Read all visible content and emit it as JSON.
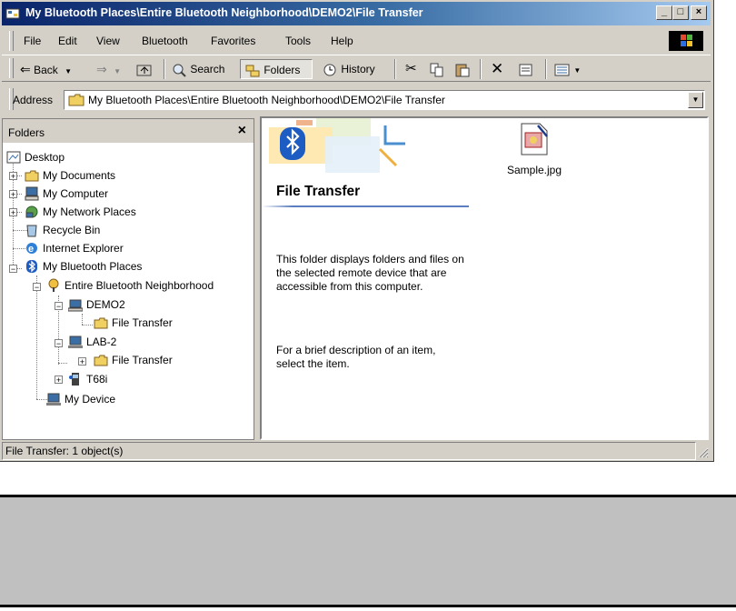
{
  "window": {
    "title": "My Bluetooth Places\\Entire Bluetooth Neighborhood\\DEMO2\\File Transfer",
    "minimize": "_",
    "maximize": "□",
    "close": "×"
  },
  "menu": [
    "File",
    "Edit",
    "View",
    "Bluetooth",
    "Favorites",
    "Tools",
    "Help"
  ],
  "toolbar": {
    "back": "Back",
    "search": "Search",
    "folders": "Folders",
    "history": "History"
  },
  "address": {
    "label": "Address",
    "value": "My Bluetooth Places\\Entire Bluetooth Neighborhood\\DEMO2\\File Transfer"
  },
  "folders_pane": {
    "title": "Folders",
    "close": "×",
    "tree": [
      {
        "label": "Desktop",
        "icon": "desktop-icon"
      },
      {
        "label": "My Documents",
        "icon": "my-documents-icon"
      },
      {
        "label": "My Computer",
        "icon": "my-computer-icon"
      },
      {
        "label": "My Network Places",
        "icon": "network-places-icon"
      },
      {
        "label": "Recycle Bin",
        "icon": "recycle-bin-icon"
      },
      {
        "label": "Internet Explorer",
        "icon": "internet-explorer-icon"
      },
      {
        "label": "My Bluetooth Places",
        "icon": "bluetooth-icon"
      },
      {
        "label": "Entire Bluetooth Neighborhood",
        "icon": "bluetooth-neighborhood-icon"
      },
      {
        "label": "DEMO2",
        "icon": "bluetooth-computer-icon"
      },
      {
        "label": "File Transfer",
        "icon": "folder-icon"
      },
      {
        "label": "LAB-2",
        "icon": "laptop-icon"
      },
      {
        "label": "File Transfer",
        "icon": "folder-icon"
      },
      {
        "label": "T68i",
        "icon": "phone-icon"
      },
      {
        "label": "My Device",
        "icon": "laptop-icon"
      }
    ]
  },
  "content": {
    "title": "File Transfer",
    "desc1": "This folder displays folders and files on the selected remote device that are accessible from this computer.",
    "desc2": "For a brief description of an item, select the item.",
    "file": {
      "name": "Sample.jpg",
      "icon": "jpg-image-icon"
    }
  },
  "status": {
    "text": "File Transfer: 1 object(s)"
  },
  "colors": {
    "titlebar_start": "#0a246a",
    "titlebar_end": "#a6caf0",
    "chrome": "#d4d0c8",
    "bluetooth": "#1d5cc2"
  }
}
